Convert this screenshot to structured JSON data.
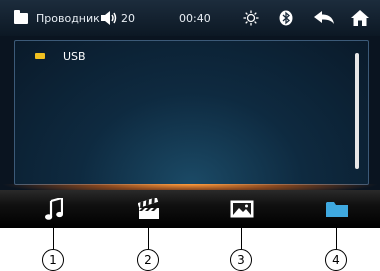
{
  "status_bar": {
    "title": "Проводник",
    "volume": "20",
    "time": "00:40"
  },
  "file_list": {
    "items": [
      {
        "label": "USB",
        "icon": "usb-drive-icon"
      }
    ]
  },
  "bottom_bar": {
    "buttons": [
      {
        "name": "music",
        "icon": "music-note-icon"
      },
      {
        "name": "video",
        "icon": "clapperboard-icon"
      },
      {
        "name": "photo",
        "icon": "image-icon"
      },
      {
        "name": "folder",
        "icon": "folder-icon"
      }
    ]
  },
  "callouts": [
    "1",
    "2",
    "3",
    "4"
  ],
  "colors": {
    "accent_glow": "#ff9a3a",
    "folder_icon": "#3fa9e0",
    "usb_icon": "#f0c020"
  }
}
